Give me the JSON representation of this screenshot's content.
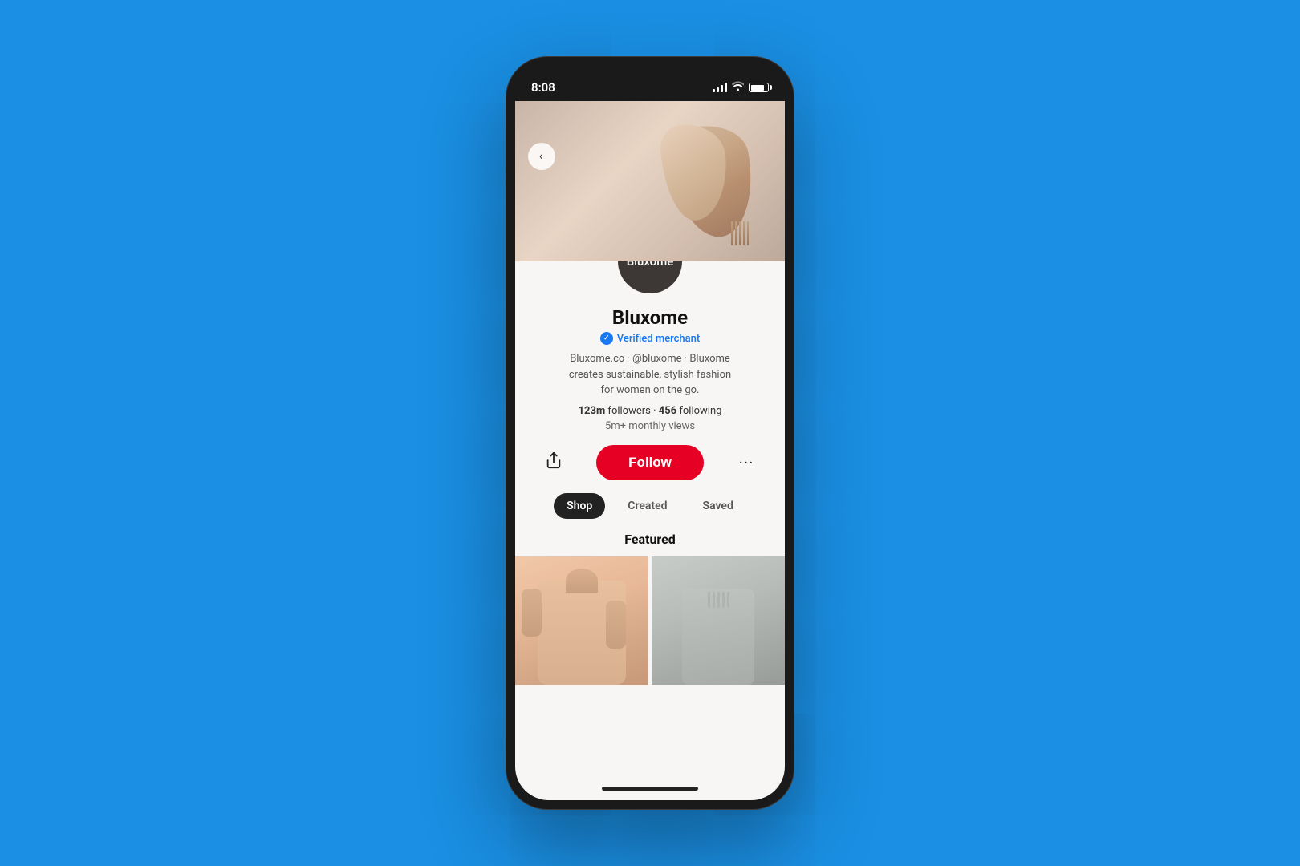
{
  "statusBar": {
    "time": "8:08",
    "battery": "80"
  },
  "profile": {
    "avatarText": "Bluxome",
    "name": "Bluxome",
    "verified": true,
    "verifiedLabel": "Verified merchant",
    "bioLine1": "Bluxome.co · @bluxome · Bluxome",
    "bioLine2": "creates sustainable, stylish fashion",
    "bioLine3": "for women on the go.",
    "followersCount": "123m",
    "followersLabel": "followers",
    "followingCount": "456",
    "followingLabel": "following",
    "monthlyViews": "5m+ monthly views"
  },
  "actions": {
    "shareLabel": "↑",
    "followLabel": "Follow",
    "moreLabel": "···"
  },
  "tabs": [
    {
      "label": "Shop",
      "active": true
    },
    {
      "label": "Created",
      "active": false
    },
    {
      "label": "Saved",
      "active": false
    }
  ],
  "featured": {
    "title": "Featured"
  },
  "colors": {
    "background": "#1a8fe3",
    "followBtn": "#e60023",
    "verifiedBlue": "#1877f2"
  }
}
